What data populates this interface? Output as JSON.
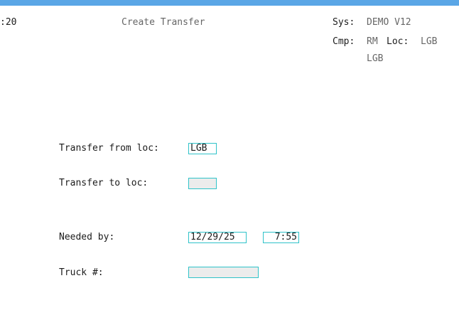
{
  "header": {
    "time_fragment": ":20",
    "title": "Create Transfer",
    "sys_label": "Sys:",
    "sys_value": "DEMO V12",
    "cmp_label": "Cmp:",
    "cmp_value": "RM",
    "loc_label": "Loc:",
    "loc_value": "LGB",
    "loc_name": "LGB"
  },
  "form": {
    "from_label": "Transfer from loc:",
    "from_value": "LGB",
    "to_label": "Transfer to loc:",
    "to_value": "",
    "needed_label": "Needed by:",
    "needed_date": "12/29/25",
    "needed_time": "7:55",
    "truck_label": "Truck #:",
    "truck_value": ""
  },
  "colors": {
    "accent_bar": "#5aa6e6",
    "field_border": "#2fc3c9",
    "field_empty_bg": "#ececec"
  }
}
